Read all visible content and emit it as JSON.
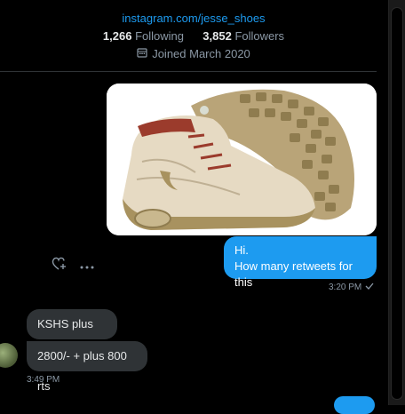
{
  "profile": {
    "link": "instagram.com/jesse_shoes",
    "following_count": "1,266",
    "following_label": "Following",
    "followers_count": "3,852",
    "followers_label": "Followers",
    "joined": "Joined March 2020"
  },
  "messages": [
    {
      "direction": "sent",
      "text_line1": "Hi.",
      "text_line2": "How many retweets for this",
      "time": "3:20 PM",
      "status_icon": "check-icon"
    },
    {
      "direction": "received",
      "text": "KSHS plus rtws"
    },
    {
      "direction": "received",
      "text": "2800/- + plus 800 rts",
      "time": "3:49 PM"
    }
  ],
  "icons": {
    "calendar": "calendar-icon",
    "react": "heart-plus-icon",
    "more": "more-icon"
  },
  "colors": {
    "accent": "#1d9bf0",
    "incoming_bubble": "#2f3336",
    "muted_text": "#8b98a5",
    "background": "#000000"
  }
}
